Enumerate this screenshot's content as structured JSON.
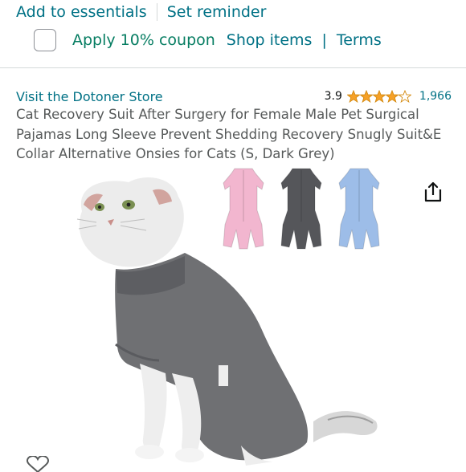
{
  "top_links": {
    "add_to_essentials": "Add to essentials",
    "set_reminder": "Set reminder"
  },
  "coupon": {
    "text": "Apply 10% coupon",
    "shop_items": "Shop items",
    "separator": "|",
    "terms": "Terms",
    "checked": false
  },
  "product": {
    "store_link": "Visit the Dotoner Store",
    "rating": "3.9",
    "rating_stars": 3.9,
    "review_count": "1,966",
    "title": "Cat Recovery Suit After Surgery for Female Male Pet Surgical Pajamas Long Sleeve Prevent Shedding Recovery Snugly Suit&E Collar Alternative Onsies for Cats (S, Dark Grey)"
  },
  "thumbnails": [
    {
      "color_name": "pink",
      "color": "#f2b6cf"
    },
    {
      "color_name": "dark grey",
      "color": "#55565a"
    },
    {
      "color_name": "light blue",
      "color": "#9dbde8"
    }
  ],
  "icons": {
    "share": "share-icon",
    "heart": "heart-icon",
    "star": "star-icon"
  },
  "colors": {
    "link": "#007185",
    "coupon_green": "#067d62",
    "star": "#f6a127",
    "text": "#0f1111",
    "muted": "#565959"
  }
}
